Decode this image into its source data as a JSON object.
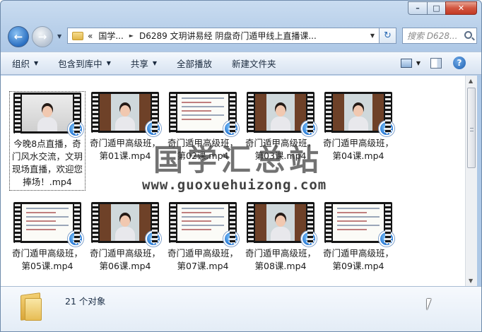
{
  "window": {
    "caption_buttons": {
      "minimize": "–",
      "maximize": "□",
      "close": "✕"
    }
  },
  "nav": {
    "back_icon": "arrow-left-icon",
    "forward_icon": "arrow-right-icon",
    "breadcrumb": [
      "«",
      "国学...",
      "D6289 文玥讲易经 阴盘奇门遁甲线上直播课..."
    ],
    "refresh_icon": "refresh-icon",
    "search_placeholder": "搜索 D628..."
  },
  "toolbar": {
    "organize": "组织",
    "include_in_library": "包含到库中",
    "share": "共享",
    "play_all": "全部播放",
    "new_folder": "新建文件夹"
  },
  "files": [
    {
      "name": "今晚8点直播，奇门风水交流，文玥现场直播，欢迎您捧场！.mp4",
      "selected": true,
      "frame": "home"
    },
    {
      "name": "奇门遁甲高级班，第01课.mp4",
      "frame": "studio"
    },
    {
      "name": "奇门遁甲高级班，第02课.mp4",
      "frame": "slide"
    },
    {
      "name": "奇门遁甲高级班，第03课.mp4",
      "frame": "studio"
    },
    {
      "name": "奇门遁甲高级班，第04课.mp4",
      "frame": "studio"
    },
    {
      "name": "奇门遁甲高级班，第05课.mp4",
      "frame": "slide"
    },
    {
      "name": "奇门遁甲高级班，第06课.mp4",
      "frame": "studio"
    },
    {
      "name": "奇门遁甲高级班，第07课.mp4",
      "frame": "slide"
    },
    {
      "name": "奇门遁甲高级班，第08课.mp4",
      "frame": "studio"
    },
    {
      "name": "奇门遁甲高级班，第09课.mp4",
      "frame": "slide"
    }
  ],
  "watermark": {
    "title": "国学汇总站",
    "url": "www.guoxuehuizong.com"
  },
  "details": {
    "count": "21 个对象"
  }
}
